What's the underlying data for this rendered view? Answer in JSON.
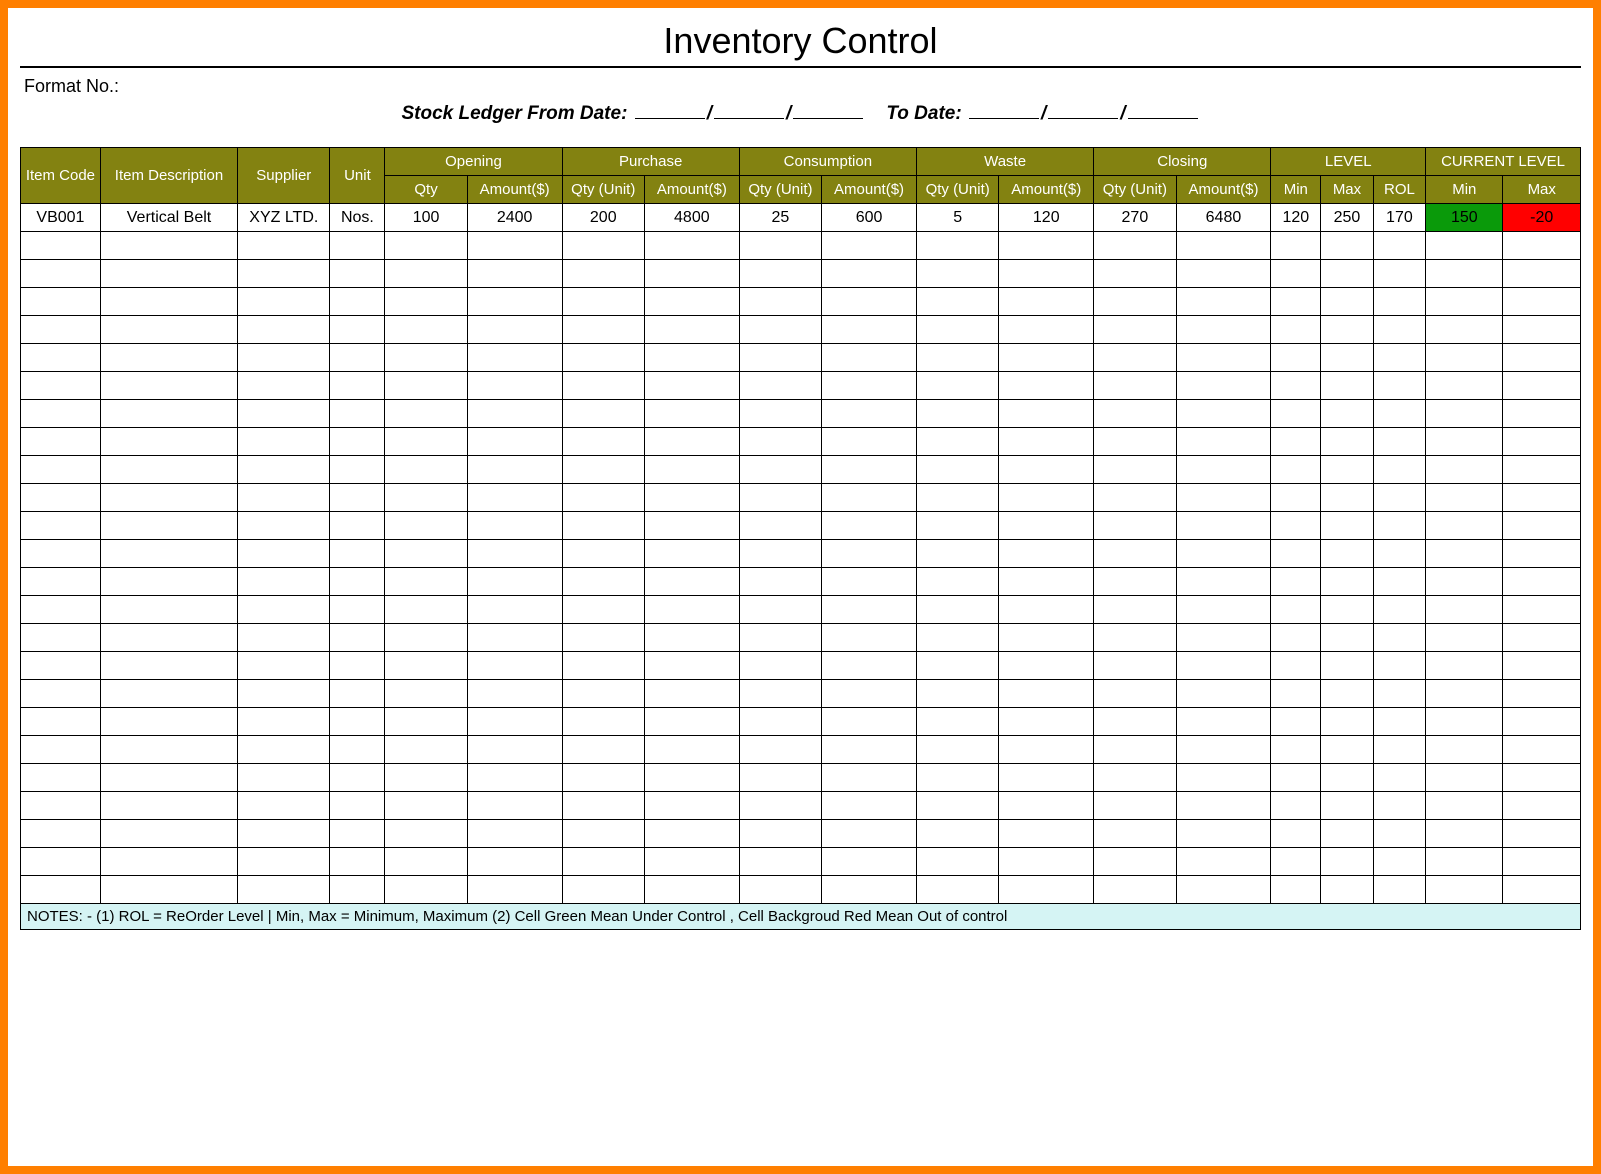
{
  "title": "Inventory Control",
  "format_no_label": "Format No.:",
  "ledger_label_from": "Stock Ledger From Date:",
  "ledger_label_to": "To Date:",
  "headers": {
    "item_code": "Item Code",
    "item_description": "Item Description",
    "supplier": "Supplier",
    "unit": "Unit",
    "opening": "Opening",
    "purchase": "Purchase",
    "consumption": "Consumption",
    "waste": "Waste",
    "closing": "Closing",
    "level": "LEVEL",
    "current_level": "CURRENT LEVEL",
    "qty": "Qty",
    "qty_unit": "Qty (Unit)",
    "amount": "Amount($)",
    "min": "Min",
    "max": "Max",
    "rol": "ROL"
  },
  "rows": [
    {
      "item_code": "VB001",
      "item_description": "Vertical Belt",
      "supplier": "XYZ LTD.",
      "unit": "Nos.",
      "opening_qty": "100",
      "opening_amt": "2400",
      "purchase_qty": "200",
      "purchase_amt": "4800",
      "consumption_qty": "25",
      "consumption_amt": "600",
      "waste_qty": "5",
      "waste_amt": "120",
      "closing_qty": "270",
      "closing_amt": "6480",
      "level_min": "120",
      "level_max": "250",
      "level_rol": "170",
      "current_min": "150",
      "current_max": "-20",
      "current_min_status": "ok",
      "current_max_status": "out"
    }
  ],
  "empty_row_count": 24,
  "notes": "NOTES: - (1) ROL = ReOrder Level | Min, Max = Minimum, Maximum     (2) Cell Green Mean Under Control , Cell Backgroud Red Mean Out of control",
  "colors": {
    "header_bg": "#838211",
    "ok_bg": "#0a9a0a",
    "out_bg": "#ff0000",
    "notes_bg": "#d5f4f4",
    "frame": "#ff7f00"
  }
}
